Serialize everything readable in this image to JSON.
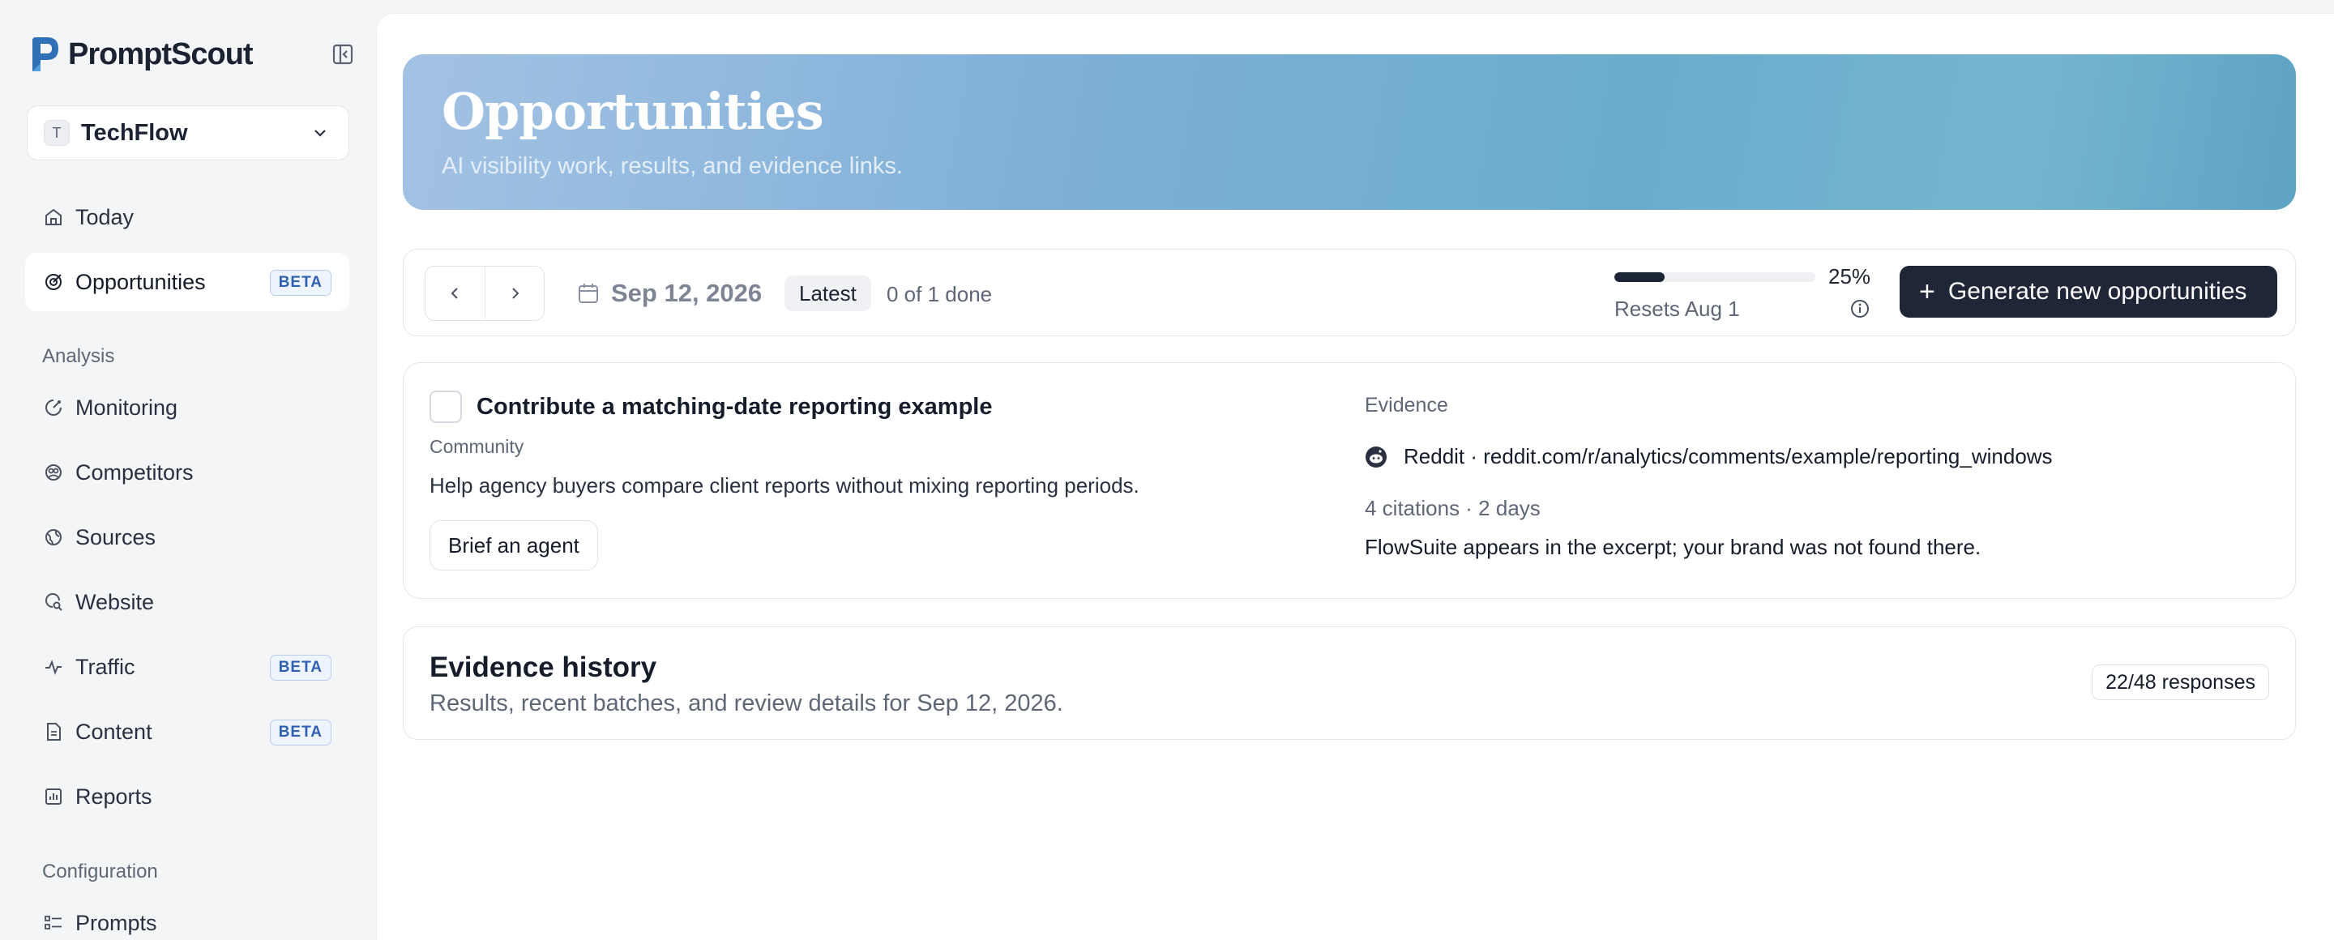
{
  "app": {
    "name": "PromptScout"
  },
  "workspace": {
    "initial": "T",
    "name": "TechFlow"
  },
  "sidebar": {
    "items": [
      {
        "label": "Today",
        "icon": "home-icon"
      },
      {
        "label": "Opportunities",
        "icon": "target-icon",
        "badge": "BETA",
        "active": true
      }
    ],
    "analysis_label": "Analysis",
    "analysis_items": [
      {
        "label": "Monitoring",
        "icon": "monitoring-icon"
      },
      {
        "label": "Competitors",
        "icon": "competitors-icon"
      },
      {
        "label": "Sources",
        "icon": "globe-icon"
      },
      {
        "label": "Website",
        "icon": "website-search-icon"
      },
      {
        "label": "Traffic",
        "icon": "activity-icon",
        "badge": "BETA"
      },
      {
        "label": "Content",
        "icon": "document-icon",
        "badge": "BETA"
      },
      {
        "label": "Reports",
        "icon": "bar-chart-icon"
      }
    ],
    "config_label": "Configuration",
    "config_items": [
      {
        "label": "Prompts",
        "icon": "list-icon"
      }
    ]
  },
  "hero": {
    "title": "Opportunities",
    "subtitle": "AI visibility work, results, and evidence links."
  },
  "toolbar": {
    "date": "Sep 12, 2026",
    "latest_label": "Latest",
    "done_text": "0 of 1 done",
    "progress": {
      "percent_label": "25%",
      "fraction": 0.25
    },
    "resets_label": "Resets Aug 1",
    "generate_label": "Generate new opportunities"
  },
  "opportunity": {
    "title": "Contribute a matching-date reporting example",
    "tag": "Community",
    "description": "Help agency buyers compare client reports without mixing reporting periods.",
    "brief_label": "Brief an agent",
    "evidence": {
      "label": "Evidence",
      "source": "Reddit · reddit.com/r/analytics/comments/example/reporting_windows",
      "meta": "4 citations · 2 days",
      "note": "FlowSuite appears in the excerpt; your brand was not found there."
    }
  },
  "history": {
    "title": "Evidence history",
    "subtitle": "Results, recent batches, and review details for Sep 12, 2026.",
    "badge": "22/48 responses"
  },
  "colors": {
    "accent_dark": "#1e2638",
    "beta_badge": "#2f5fb0",
    "hero_gradient_start": "#a3c2e4",
    "hero_gradient_end": "#5ea3c3",
    "reddit_icon": "#2a3040"
  }
}
